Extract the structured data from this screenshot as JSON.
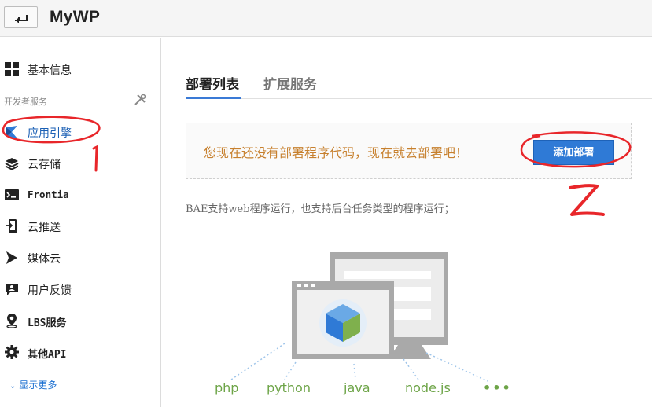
{
  "header": {
    "title": "MyWP",
    "back_icon": "return-arrow-icon"
  },
  "sidebar": {
    "items_top": [
      {
        "label": "基本信息",
        "icon": "grid-icon"
      }
    ],
    "section_label": "开发者服务",
    "items": [
      {
        "label": "应用引擎",
        "icon": "app-engine-icon",
        "active": true
      },
      {
        "label": "云存储",
        "icon": "layers-icon"
      },
      {
        "label": "Frontia",
        "icon": "terminal-icon"
      },
      {
        "label": "云推送",
        "icon": "push-phone-icon"
      },
      {
        "label": "媒体云",
        "icon": "media-play-icon"
      },
      {
        "label": "用户反馈",
        "icon": "feedback-icon"
      },
      {
        "label": "LBS服务",
        "icon": "location-pin-icon"
      },
      {
        "label": "其他API",
        "icon": "gear-icon"
      }
    ],
    "show_more": "显示更多"
  },
  "tabs": [
    {
      "label": "部署列表",
      "active": true
    },
    {
      "label": "扩展服务",
      "active": false
    }
  ],
  "notice": {
    "text": "您现在还没有部署程序代码，现在就去部署吧！",
    "button": "添加部署"
  },
  "description": "BAE支持web程序运行，也支持后台任务类型的程序运行；",
  "languages": [
    "php",
    "python",
    "java",
    "node.js",
    "•••"
  ],
  "colors": {
    "accent": "#2f7ad6",
    "notice_text": "#c7802e",
    "lang_text": "#6da447",
    "annotation": "#e8262a"
  }
}
